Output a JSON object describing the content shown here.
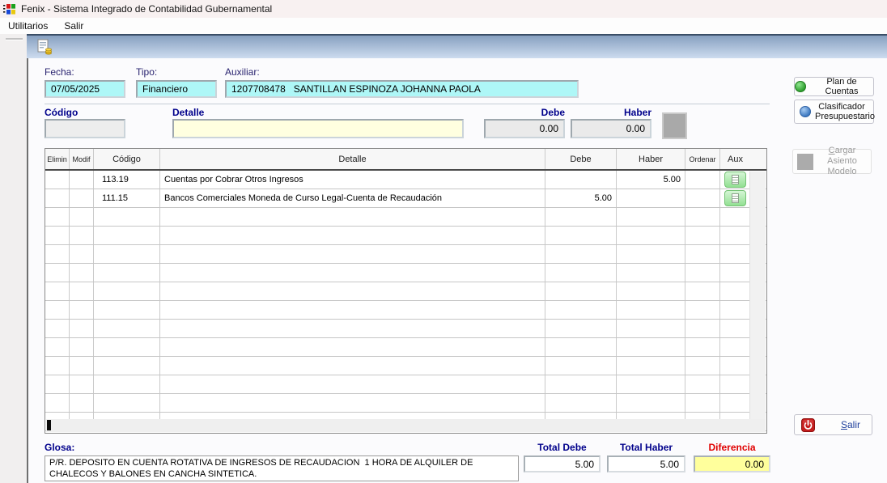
{
  "window": {
    "title": "Fenix - Sistema Integrado de Contabilidad Gubernamental",
    "icon": "windows-logo-icon"
  },
  "menu": {
    "items": [
      {
        "label": "Utilitarios"
      },
      {
        "label": "Salir"
      }
    ]
  },
  "toolbar": {
    "icon": "journal-document-icon"
  },
  "header_form": {
    "fecha": {
      "label": "Fecha:",
      "value": "07/05/2025"
    },
    "tipo": {
      "label": "Tipo:",
      "value": "Financiero"
    },
    "auxiliar": {
      "label": "Auxiliar:",
      "value": "1207708478   SANTILLAN ESPINOZA JOHANNA PAOLA"
    }
  },
  "entry_form": {
    "codigo": {
      "label": "Código",
      "value": ""
    },
    "detalle": {
      "label": "Detalle",
      "value": ""
    },
    "debe": {
      "label": "Debe",
      "value": "0.00"
    },
    "haber": {
      "label": "Haber",
      "value": "0.00"
    }
  },
  "table": {
    "columns": [
      "Elimin",
      "Modif",
      "Código",
      "Detalle",
      "Debe",
      "Haber",
      "Ordenar",
      "Aux"
    ],
    "rows": [
      {
        "elimin": "",
        "modif": "",
        "codigo": "113.19",
        "detalle": "Cuentas por Cobrar Otros Ingresos",
        "debe": "",
        "haber": "5.00",
        "ordenar": "",
        "aux": true,
        "aux_icon": "document-icon"
      },
      {
        "elimin": "",
        "modif": "",
        "codigo": "111.15",
        "detalle": "Bancos Comerciales Moneda de Curso Legal-Cuenta de Recaudación",
        "debe": "5.00",
        "haber": "",
        "ordenar": "",
        "aux": true,
        "aux_icon": "document-icon"
      }
    ],
    "empty_row_count": 12
  },
  "side_buttons": {
    "plan_de_cuentas": {
      "label": "Plan de Cuentas",
      "icon": "green-sphere-icon"
    },
    "clasificador": {
      "label": "Clasificador Presupuestario",
      "icon": "blue-sphere-icon"
    },
    "cargar_asiento": {
      "label": "Cargar Asiento Modelo",
      "icon": "gray-square-icon",
      "disabled": true
    },
    "salir": {
      "label": "Salir",
      "icon": "power-icon"
    }
  },
  "footer": {
    "glosa": {
      "label": "Glosa:",
      "value": "P/R. DEPOSITO EN CUENTA ROTATIVA DE INGRESOS DE RECAUDACION  1 HORA DE ALQUILER DE CHALECOS Y BALONES EN CANCHA SINTETICA."
    },
    "total_debe": {
      "label": "Total Debe",
      "value": "5.00"
    },
    "total_haber": {
      "label": "Total Haber",
      "value": "5.00"
    },
    "diferencia": {
      "label": "Diferencia",
      "value": "0.00"
    }
  },
  "colors": {
    "field_cyan": "#AEF7F7",
    "field_cream": "#FFFFE0",
    "field_gray": "#EAEAEA",
    "label_navy": "#00008B",
    "diferencia_red": "#E00000",
    "diferencia_bg": "#FFFF9C",
    "toolbar_gradient_top": "#87A0C0",
    "toolbar_gradient_bottom": "#CDDCEF",
    "aux_button_green": "#92E092"
  }
}
